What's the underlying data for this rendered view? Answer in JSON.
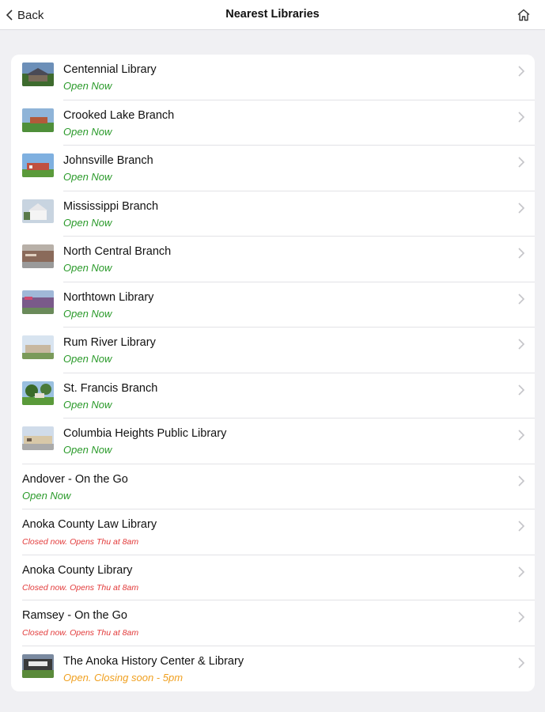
{
  "nav": {
    "back_label": "Back",
    "title": "Nearest Libraries"
  },
  "libraries": [
    {
      "name": "Centennial Library",
      "status": "Open Now",
      "status_type": "open",
      "has_photo": true
    },
    {
      "name": "Crooked Lake Branch",
      "status": "Open Now",
      "status_type": "open",
      "has_photo": true
    },
    {
      "name": "Johnsville Branch",
      "status": "Open Now",
      "status_type": "open",
      "has_photo": true
    },
    {
      "name": "Mississippi Branch",
      "status": "Open Now",
      "status_type": "open",
      "has_photo": true
    },
    {
      "name": "North Central Branch",
      "status": "Open Now",
      "status_type": "open",
      "has_photo": true
    },
    {
      "name": "Northtown Library",
      "status": "Open Now",
      "status_type": "open",
      "has_photo": true
    },
    {
      "name": "Rum River Library",
      "status": "Open Now",
      "status_type": "open",
      "has_photo": true
    },
    {
      "name": "St. Francis Branch",
      "status": "Open Now",
      "status_type": "open",
      "has_photo": true
    },
    {
      "name": "Columbia Heights Public Library",
      "status": "Open Now",
      "status_type": "open",
      "has_photo": true
    },
    {
      "name": "Andover - On the Go",
      "status": "Open Now",
      "status_type": "open",
      "has_photo": false
    },
    {
      "name": "Anoka County Law Library",
      "status": "Closed now. Opens Thu at 8am",
      "status_type": "closed",
      "has_photo": false
    },
    {
      "name": "Anoka County Library",
      "status": "Closed now. Opens Thu at 8am",
      "status_type": "closed",
      "has_photo": false
    },
    {
      "name": "Ramsey - On the Go",
      "status": "Closed now. Opens Thu at 8am",
      "status_type": "closed",
      "has_photo": false
    },
    {
      "name": "The Anoka History Center & Library",
      "status": "Open. Closing soon - 5pm",
      "status_type": "soon",
      "has_photo": true
    }
  ],
  "icons": {
    "back": "chevron-left-icon",
    "home": "home-icon",
    "row_disclosure": "chevron-right-icon"
  },
  "colors": {
    "open": "#2a9a2a",
    "closed": "#e23a3a",
    "soon": "#f0a020"
  }
}
